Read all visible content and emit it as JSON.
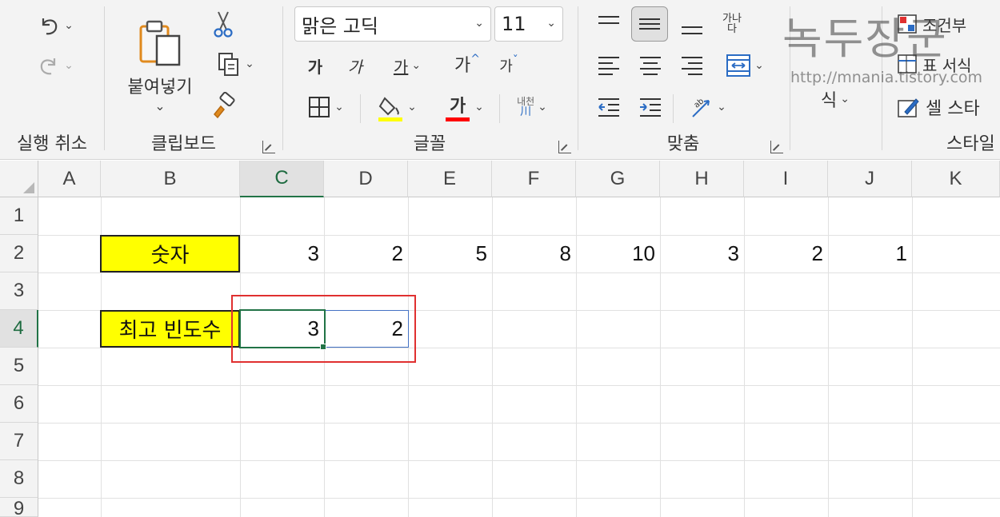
{
  "ribbon": {
    "undo_group": {
      "label": "실행 취소",
      "undo_icon": "undo-icon",
      "redo_icon": "redo-icon"
    },
    "clipboard": {
      "label": "클립보드",
      "paste_label": "붙여넣기",
      "paste_icon": "paste-icon",
      "cut_icon": "scissors-icon",
      "copy_icon": "copy-icon",
      "format_painter_icon": "format-painter-icon"
    },
    "font": {
      "label": "글꼴",
      "font_name": "맑은 고딕",
      "font_size": "11",
      "bold": "가",
      "italic": "가",
      "underline": "가",
      "grow": "가",
      "shrink": "가",
      "font_color_glyph": "가",
      "phonetic": "내천",
      "fill_color": "#ffff00",
      "text_color": "#ff0000"
    },
    "alignment": {
      "label": "맞춤",
      "wrap_glyph": "가나\n다"
    },
    "number": {
      "label": "식"
    },
    "styles": {
      "label": "스타일",
      "conditional": "조건부",
      "table_format": "표 서식",
      "cell_styles": "셀 스타"
    },
    "watermark": {
      "title": "녹두장군",
      "url": "http://mnania.tistory.com"
    }
  },
  "sheet": {
    "columns": [
      "A",
      "B",
      "C",
      "D",
      "E",
      "F",
      "G",
      "H",
      "I",
      "J",
      "K"
    ],
    "rows": [
      "1",
      "2",
      "3",
      "4",
      "5",
      "6",
      "7",
      "8",
      "9"
    ],
    "selected_column": "C",
    "selected_row": "4",
    "row2_label": "숫자",
    "row2_values": [
      "3",
      "2",
      "5",
      "8",
      "10",
      "3",
      "2",
      "1"
    ],
    "row4_label": "최고 빈도수",
    "row4_values": [
      "3",
      "2"
    ],
    "label_fill": "#ffff00",
    "accent": "#217346",
    "highlight": "#e03030"
  }
}
